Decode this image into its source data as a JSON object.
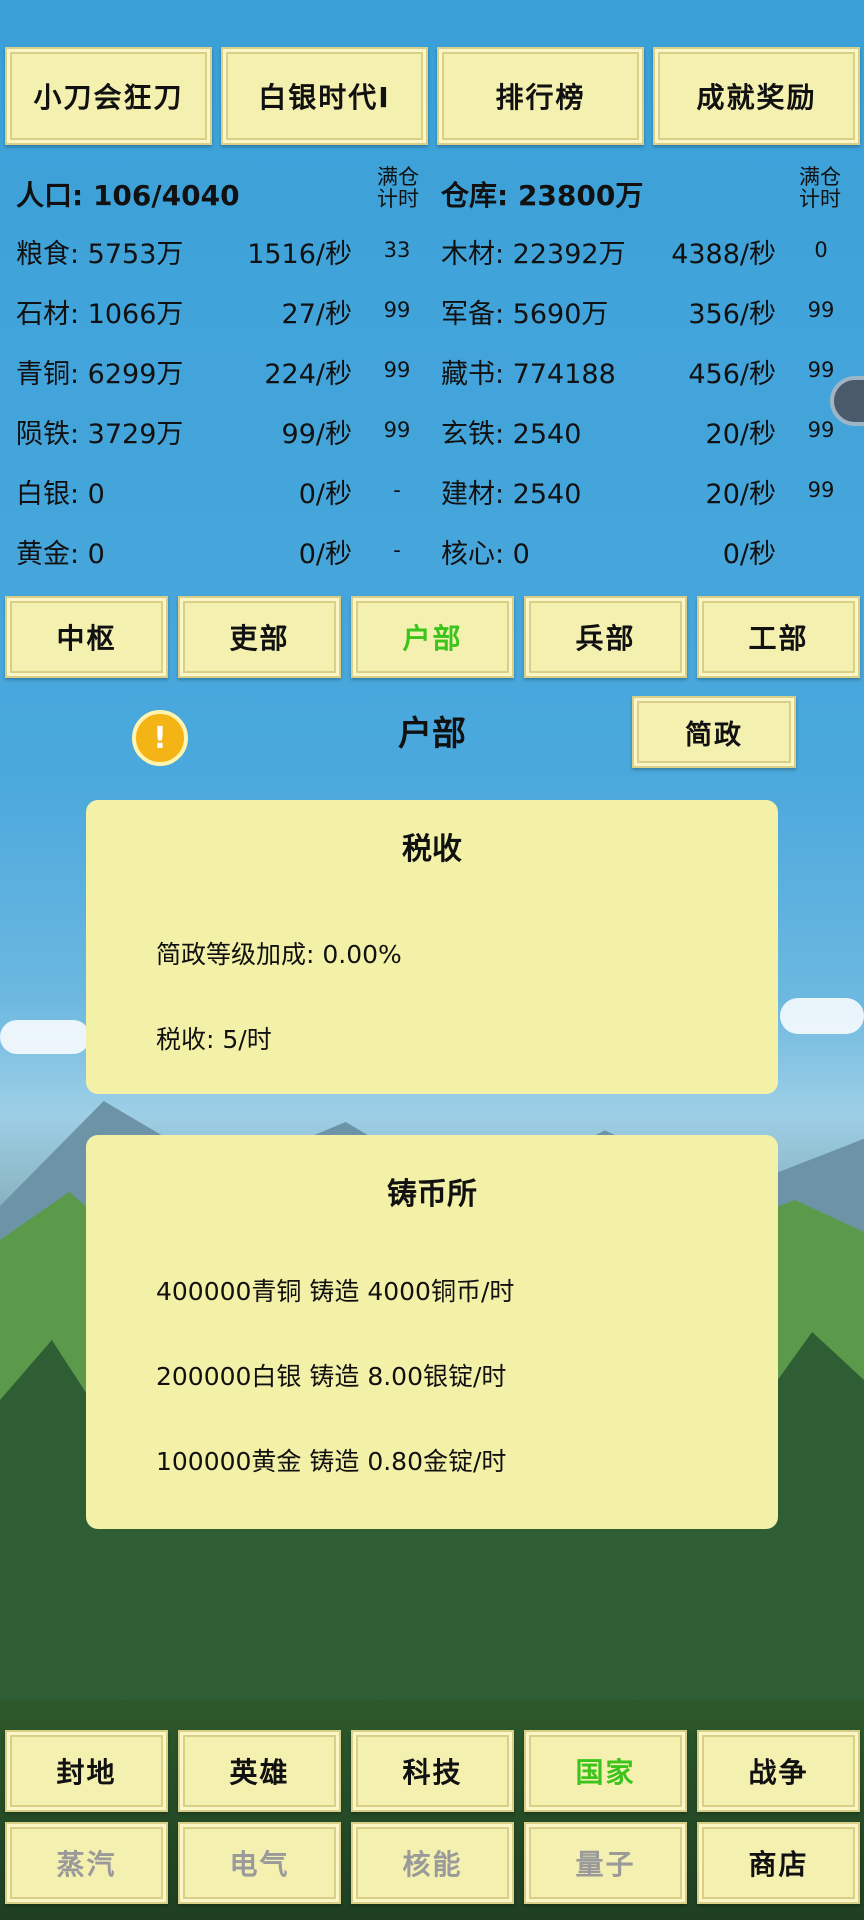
{
  "top_nav": [
    "小刀会狂刀",
    "白银时代Ⅰ",
    "排行榜",
    "成就奖励"
  ],
  "stats": {
    "population": "人口: 106/4040",
    "warehouse": "仓库: 23800万",
    "full_label": "满仓\n计时",
    "left": [
      {
        "label": "粮食: 5753万",
        "rate": "1516/秒",
        "timer": "33"
      },
      {
        "label": "石材: 1066万",
        "rate": "27/秒",
        "timer": "99"
      },
      {
        "label": "青铜: 6299万",
        "rate": "224/秒",
        "timer": "99"
      },
      {
        "label": "陨铁: 3729万",
        "rate": "99/秒",
        "timer": "99"
      },
      {
        "label": "白银: 0",
        "rate": "0/秒",
        "timer": "-"
      },
      {
        "label": "黄金: 0",
        "rate": "0/秒",
        "timer": "-"
      }
    ],
    "right": [
      {
        "label": "木材: 22392万",
        "rate": "4388/秒",
        "timer": "0"
      },
      {
        "label": "军备: 5690万",
        "rate": "356/秒",
        "timer": "99"
      },
      {
        "label": "藏书: 774188",
        "rate": "456/秒",
        "timer": "99"
      },
      {
        "label": "玄铁: 2540",
        "rate": "20/秒",
        "timer": "99"
      },
      {
        "label": "建材: 2540",
        "rate": "20/秒",
        "timer": "99"
      },
      {
        "label": "核心: 0",
        "rate": "0/秒",
        "timer": ""
      }
    ]
  },
  "dept_tabs": [
    {
      "label": "中枢",
      "active": false
    },
    {
      "label": "吏部",
      "active": false
    },
    {
      "label": "户部",
      "active": true
    },
    {
      "label": "兵部",
      "active": false
    },
    {
      "label": "工部",
      "active": false
    }
  ],
  "dept": {
    "warning_icon": "!",
    "title": "户部",
    "action_button": "简政"
  },
  "tax_panel": {
    "title": "税收",
    "lines": [
      "简政等级加成: 0.00%",
      "税收: 5/时"
    ]
  },
  "mint_panel": {
    "title": "铸币所",
    "lines": [
      "400000青铜 铸造 4000铜币/时",
      "200000白银 铸造 8.00银锭/时",
      "100000黄金 铸造 0.80金锭/时"
    ]
  },
  "bottom_nav_row1": [
    {
      "label": "封地",
      "state": "normal"
    },
    {
      "label": "英雄",
      "state": "normal"
    },
    {
      "label": "科技",
      "state": "normal"
    },
    {
      "label": "国家",
      "state": "active"
    },
    {
      "label": "战争",
      "state": "normal"
    }
  ],
  "bottom_nav_row2": [
    {
      "label": "蒸汽",
      "state": "disabled"
    },
    {
      "label": "电气",
      "state": "disabled"
    },
    {
      "label": "核能",
      "state": "disabled"
    },
    {
      "label": "量子",
      "state": "disabled"
    },
    {
      "label": "商店",
      "state": "normal"
    }
  ],
  "colors": {
    "active_text": "#3cc41c",
    "button_bg": "#f4f0b0",
    "panel_bg": "#f3f1a8",
    "sky": "#3a9bd4"
  }
}
